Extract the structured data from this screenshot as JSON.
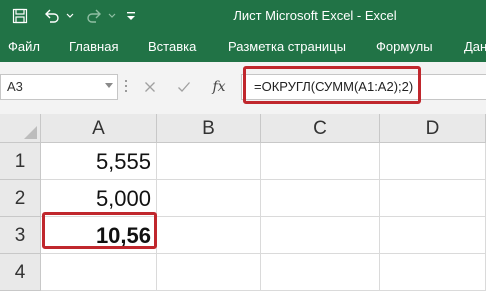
{
  "window": {
    "title": "Лист Microsoft Excel  -  Excel"
  },
  "quick_access": {
    "save_icon": "save-icon",
    "undo_icon": "undo-icon",
    "redo_icon": "redo-icon",
    "customize_icon": "customize-quick-access-icon"
  },
  "ribbon": {
    "tabs": [
      "Файл",
      "Главная",
      "Вставка",
      "Разметка страницы",
      "Формулы",
      "Дан"
    ]
  },
  "formula_bar": {
    "name_box": "A3",
    "cancel_icon": "cancel-icon",
    "enter_icon": "enter-icon",
    "fx_label": "fx",
    "formula": "=ОКРУГЛ(СУММ(A1:A2);2)"
  },
  "grid": {
    "columns": [
      "A",
      "B",
      "C",
      "D"
    ],
    "rows": [
      "1",
      "2",
      "3",
      "4"
    ],
    "cells": {
      "A1": "5,555",
      "A2": "5,000",
      "A3": "10,56"
    }
  },
  "colors": {
    "excel_green": "#217346",
    "highlight_red": "#c0272d",
    "header_gray": "#e9e9e9"
  }
}
